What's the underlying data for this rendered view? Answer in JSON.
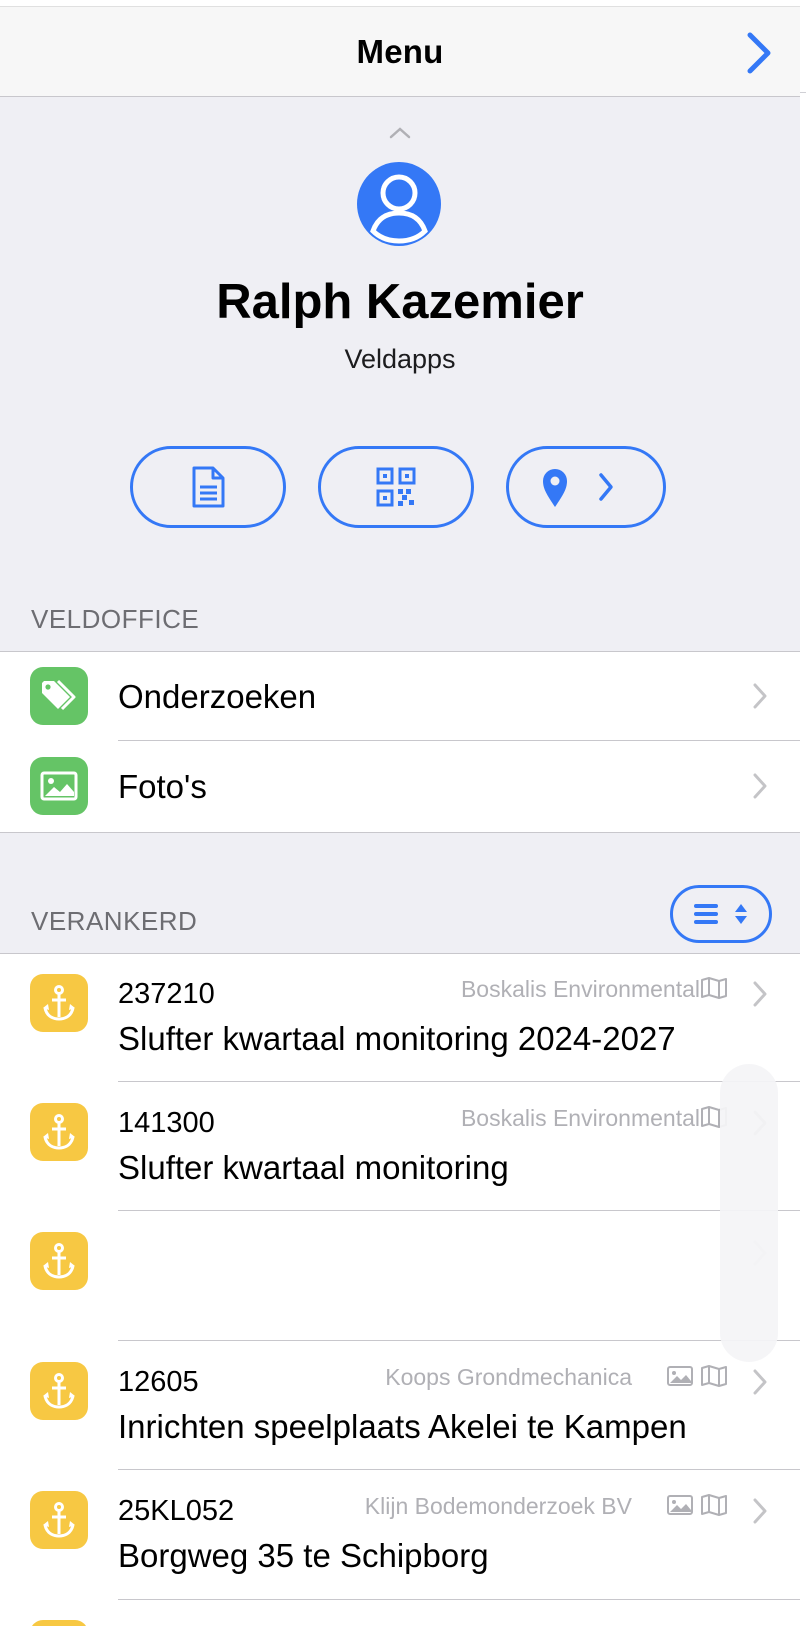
{
  "navbar": {
    "title": "Menu",
    "next_icon": "chevron-right-icon"
  },
  "profile": {
    "name": "Ralph Kazemier",
    "organization": "Veldapps",
    "avatar_icon": "person-circle-icon",
    "actions": [
      {
        "icon": "document-icon"
      },
      {
        "icon": "qr-code-icon"
      },
      {
        "icon": "location-pin-icon"
      }
    ]
  },
  "sections": {
    "veldoffice": {
      "header": "VELDOFFICE",
      "items": [
        {
          "label": "Onderzoeken",
          "icon": "tags-icon"
        },
        {
          "label": "Foto's",
          "icon": "photo-icon"
        }
      ]
    },
    "verankerd": {
      "header": "VERANKERD",
      "sort_icon": "list-sort-icon",
      "items": [
        {
          "number": "237210",
          "title": "Slufter kwartaal monitoring 2024-2027",
          "company": "Boskalis Environmental",
          "icons": [
            "map-icon"
          ]
        },
        {
          "number": "141300",
          "title": "Slufter kwartaal monitoring",
          "company": "Boskalis Environmental",
          "icons": [
            "map-icon"
          ]
        },
        {
          "number": "",
          "title": "",
          "company": "",
          "icons": []
        },
        {
          "number": "12605",
          "title": "Inrichten speelplaats Akelei te Kampen",
          "company": "Koops Grondmechanica",
          "icons": [
            "photo-icon",
            "map-icon"
          ]
        },
        {
          "number": "25KL052",
          "title": "Borgweg 35 te Schipborg",
          "company": "Klijn Bodemonderzoek BV",
          "icons": [
            "photo-icon",
            "map-icon"
          ]
        }
      ]
    }
  },
  "colors": {
    "accent": "#3478f6",
    "green": "#65c466",
    "yellow": "#f7c843",
    "background": "#efeff4"
  }
}
